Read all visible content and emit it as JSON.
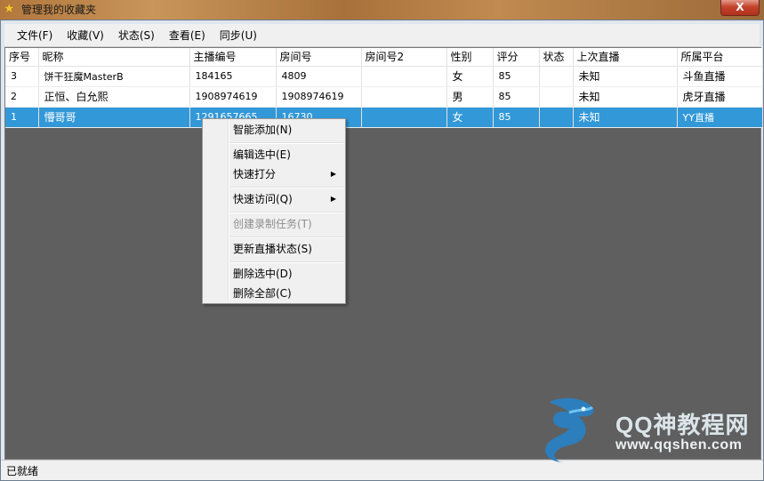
{
  "window": {
    "title": "管理我的收藏夹",
    "close_label": "X"
  },
  "menubar": {
    "items": [
      "文件(F)",
      "收藏(V)",
      "状态(S)",
      "查看(E)",
      "同步(U)"
    ]
  },
  "table": {
    "columns": [
      "序号",
      "昵称",
      "主播编号",
      "房间号",
      "房间号2",
      "性别",
      "评分",
      "状态",
      "上次直播",
      "所属平台"
    ],
    "rows": [
      {
        "seq": "3",
        "nickname": "饼干狂魔MasterB",
        "host_id": "184165",
        "room": "4809",
        "room2": "",
        "gender": "女",
        "score": "85",
        "status": "",
        "last_live": "未知",
        "platform": "斗鱼直播"
      },
      {
        "seq": "2",
        "nickname": "正恒、白允熙",
        "host_id": "1908974619",
        "room": "1908974619",
        "room2": "",
        "gender": "男",
        "score": "85",
        "status": "",
        "last_live": "未知",
        "platform": "虎牙直播"
      },
      {
        "seq": "1",
        "nickname": "懵哥哥",
        "host_id": "1291657665",
        "room": "16730",
        "room2": "",
        "gender": "女",
        "score": "85",
        "status": "",
        "last_live": "未知",
        "platform": "YY直播"
      }
    ],
    "selected_row": 2
  },
  "context_menu": {
    "items": [
      {
        "label": "智能添加(N)"
      },
      {
        "label": "编辑选中(E)"
      },
      {
        "label": "快速打分"
      },
      {
        "label": "快速访问(Q)"
      },
      {
        "label": "创建录制任务(T)"
      },
      {
        "label": "更新直播状态(S)"
      },
      {
        "label": "删除选中(D)"
      },
      {
        "label": "删除全部(C)"
      }
    ]
  },
  "statusbar": {
    "text": "已就绪"
  },
  "watermark": {
    "line1": "QQ神教程网",
    "line2": "www.qqshen.com"
  },
  "colors": {
    "selection": "#3298d8",
    "background": "#5f5f5f",
    "title_gradient": "#b2773c"
  }
}
